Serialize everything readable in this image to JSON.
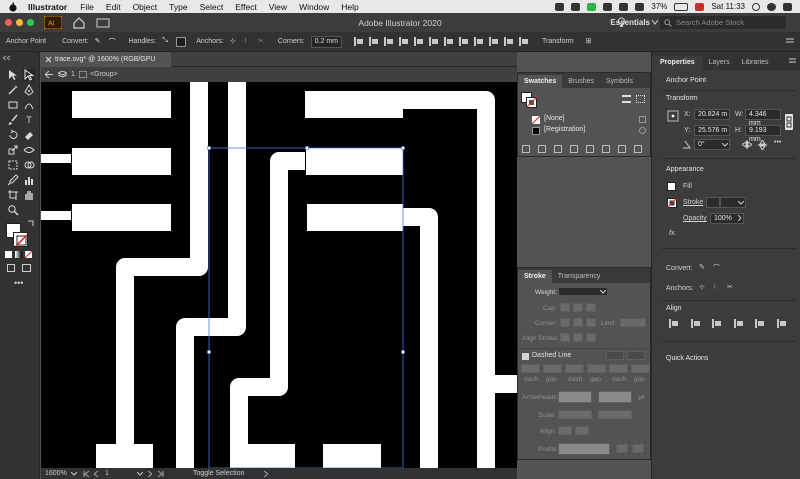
{
  "menubar": {
    "app": "Illustrator",
    "items": [
      "File",
      "Edit",
      "Object",
      "Type",
      "Select",
      "Effect",
      "View",
      "Window",
      "Help"
    ],
    "battery": "37%",
    "clock": "Sat 11:33"
  },
  "titlebar": {
    "title": "Adobe Illustrator 2020",
    "workspace": "Essentials",
    "search_placeholder": "Search Adobe Stock"
  },
  "controlbar": {
    "tool_name": "Anchor Point",
    "convert_label": "Convert:",
    "handles_label": "Handles:",
    "anchors_label": "Anchors:",
    "corners_label": "Corners:",
    "corners_value": "0.2 mm",
    "transform_label": "Transform"
  },
  "document": {
    "tab_title": "trace.svg* @ 1600% (RGB/GPU Preview)",
    "breadcrumb_num": "1",
    "breadcrumb_group": "<Group>"
  },
  "statusbar": {
    "zoom": "1600%",
    "artboard": "1",
    "status_text": "Toggle Selection"
  },
  "swatches_panel": {
    "tabs": [
      "Swatches",
      "Brushes",
      "Symbols"
    ],
    "items": [
      "[None]",
      "[Registration]"
    ]
  },
  "stroke_panel": {
    "tabs": [
      "Stroke",
      "Transparency"
    ],
    "weight_label": "Weight:",
    "cap_label": "Cap:",
    "corner_label": "Corner:",
    "limit_label": "Limit:",
    "align_stroke_label": "Align Stroke:",
    "dashed_line_label": "Dashed Line",
    "dash_gap_labels": [
      "dash",
      "gap",
      "dash",
      "gap",
      "dash",
      "gap"
    ],
    "arrowheads_label": "Arrowheads:",
    "scale_label": "Scale:",
    "align_label": "Align:",
    "profile_label": "Profile:"
  },
  "properties_panel": {
    "tabs": [
      "Properties",
      "Layers",
      "Libraries"
    ],
    "selection_name": "Anchor Point",
    "transform_title": "Transform",
    "x_label": "X:",
    "x_value": "20.824 m",
    "y_label": "Y:",
    "y_value": "25.576 m",
    "w_label": "W:",
    "w_value": "4.346 mm",
    "h_label": "H:",
    "h_value": "9.193 mm",
    "angle_value": "0°",
    "appearance_title": "Appearance",
    "fill_label": "Fill",
    "stroke_label": "Stroke",
    "opacity_label": "Opacity",
    "opacity_value": "100%",
    "fx_label": "fx.",
    "convert_label": "Convert:",
    "anchors_label": "Anchors:",
    "align_title": "Align",
    "quick_actions_title": "Quick Actions"
  },
  "colors": {
    "accent_selection": "#4b7bec",
    "canvas_bg": "#000000",
    "artwork": "#ffffff"
  }
}
